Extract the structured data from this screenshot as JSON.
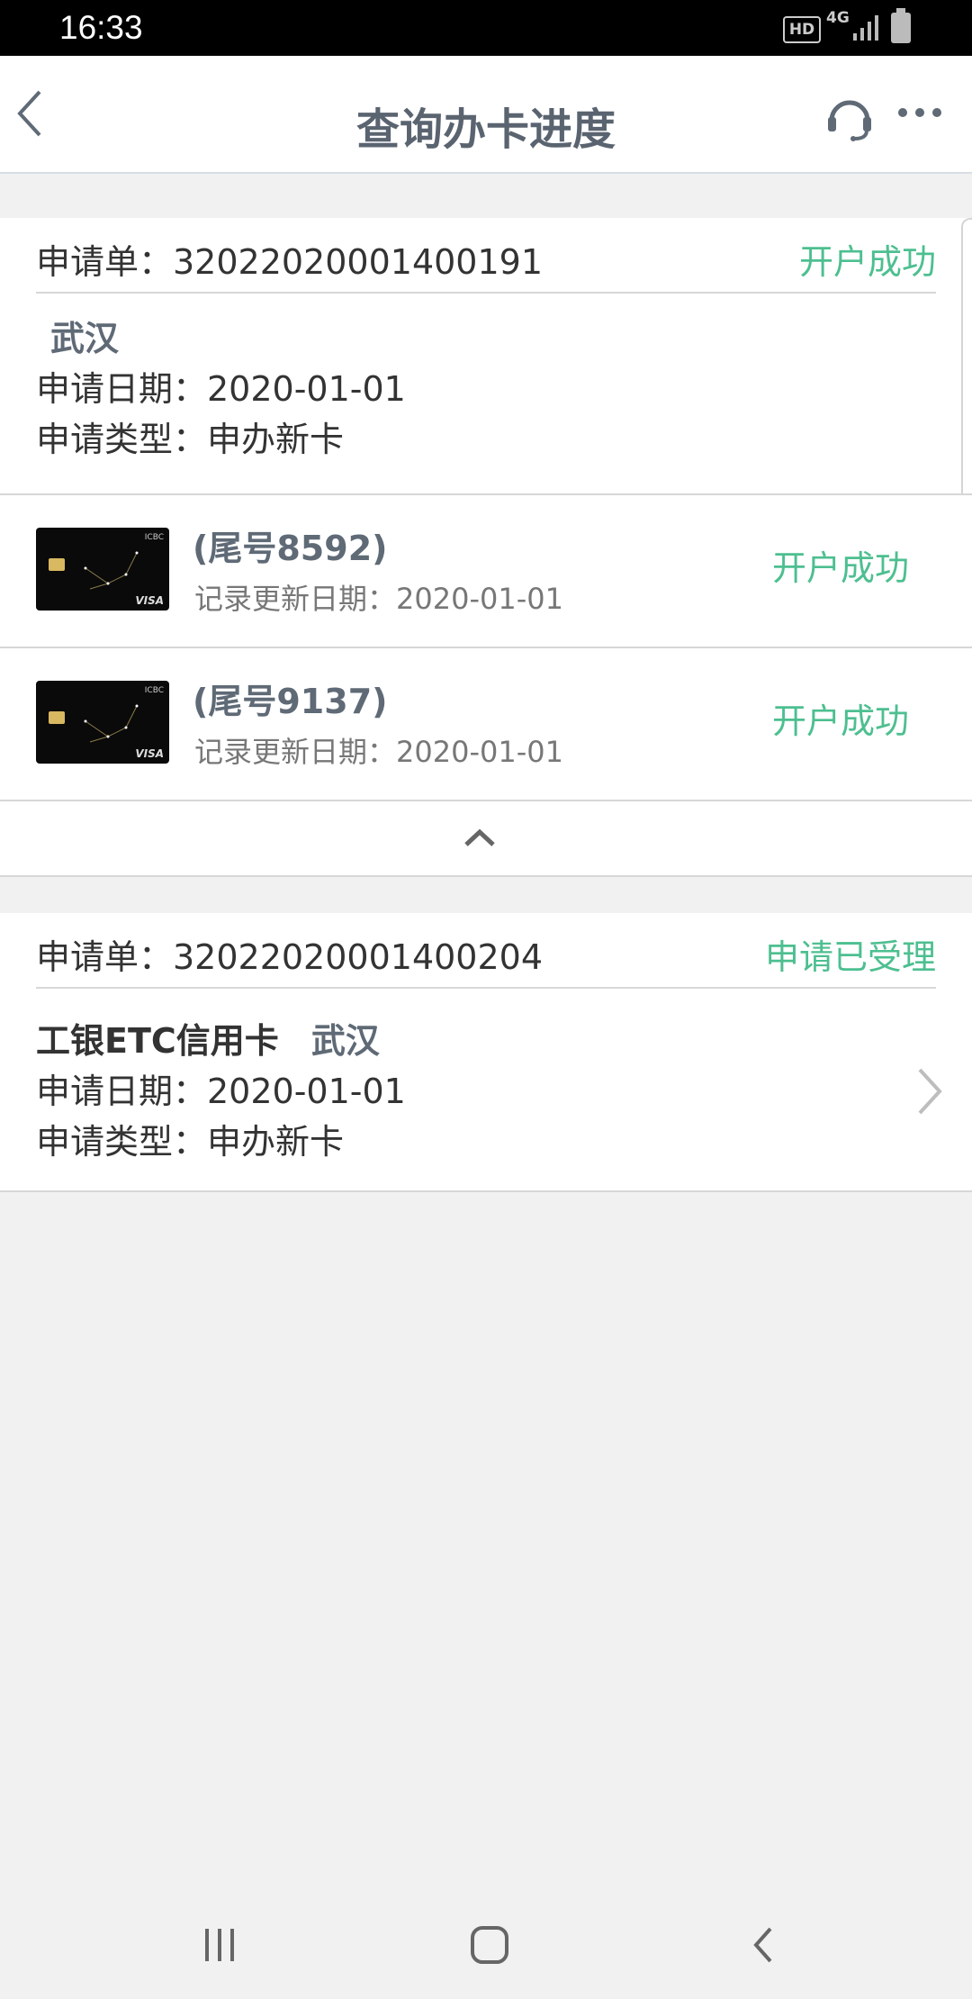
{
  "status_bar": {
    "time": "16:33",
    "hd_badge": "HD",
    "network": "4G"
  },
  "header": {
    "title": "查询办卡进度",
    "back_icon": "chevron-left-icon",
    "support_icon": "headset-icon",
    "more_icon": "more-horizontal-icon"
  },
  "applications": [
    {
      "number_label": "申请单：32022020001400191",
      "status": "开户成功",
      "city": "武汉",
      "date_label": "申请日期：2020-01-01",
      "type_label": "申请类型：申办新卡",
      "cards": [
        {
          "title": "(尾号8592)",
          "updated": "记录更新日期：2020-01-01",
          "status": "开户成功"
        },
        {
          "title": "(尾号9137)",
          "updated": "记录更新日期：2020-01-01",
          "status": "开户成功"
        }
      ]
    },
    {
      "number_label": "申请单：32022020001400204",
      "status": "申请已受理",
      "product": "工银ETC信用卡",
      "city": "武汉",
      "date_label": "申请日期：2020-01-01",
      "type_label": "申请类型：申办新卡"
    }
  ],
  "card_image": {
    "brand": "ICBC",
    "network": "VISA"
  },
  "colors": {
    "success": "#4dbf90",
    "title": "#5a6470",
    "background": "#f1f1f1"
  }
}
